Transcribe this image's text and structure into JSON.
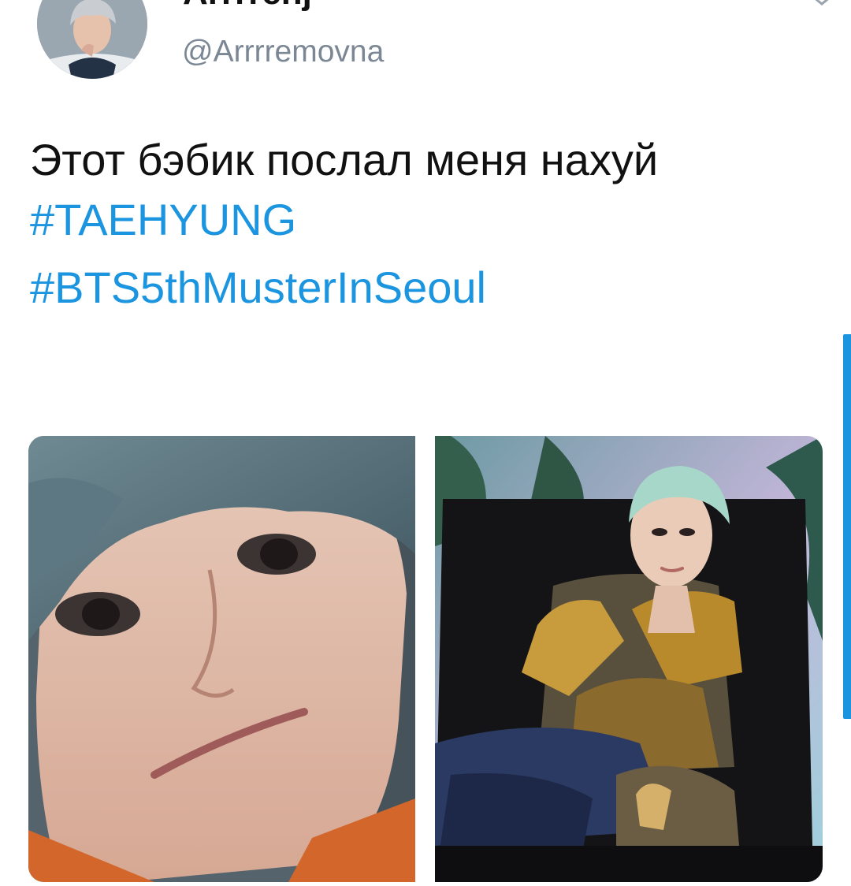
{
  "tweet": {
    "display_name": "Arrrrenj",
    "handle": "@Arrrremovna",
    "text": "Этот бэбик послал меня нахуй",
    "hashtags": [
      "#TAEHYUNG",
      "#BTS5thMusterInSeoul"
    ],
    "link_color": "#1b95e0"
  },
  "media": {
    "photos": [
      {
        "name": "close-up selfie photo"
      },
      {
        "name": "seated photoshoot photo"
      }
    ]
  }
}
